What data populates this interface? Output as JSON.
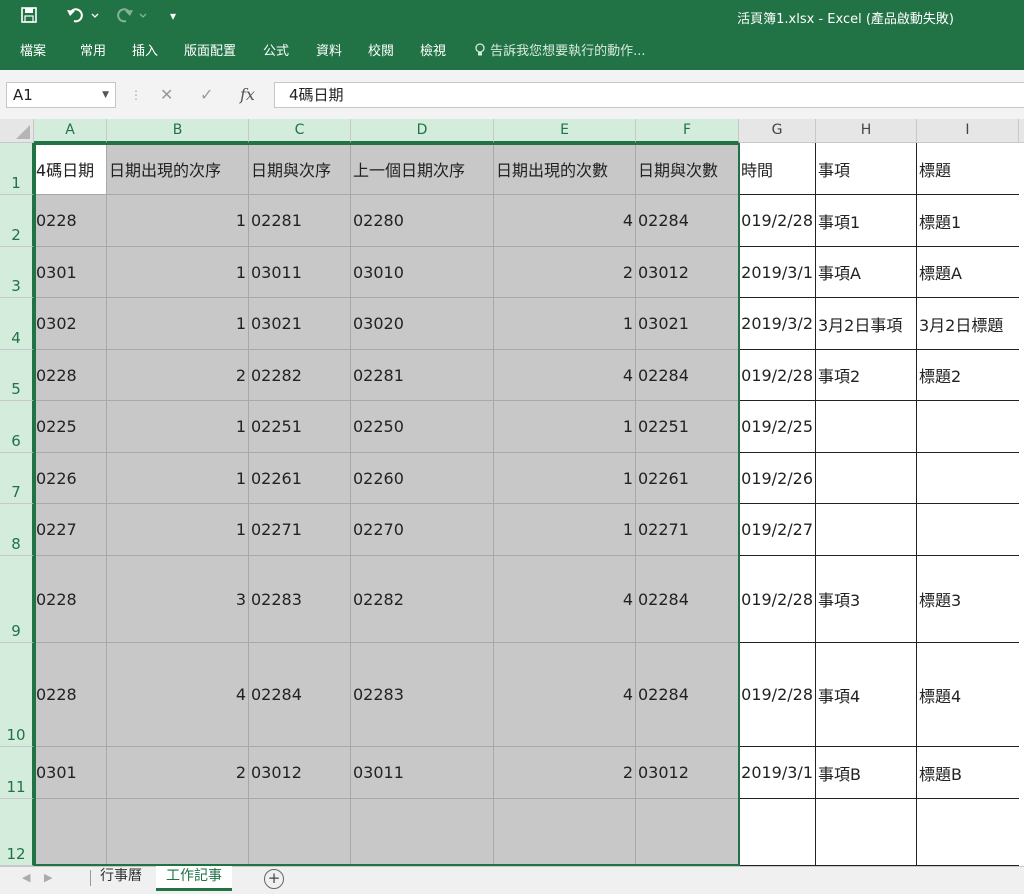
{
  "window": {
    "title": "活頁簿1.xlsx - Excel (產品啟動失敗)"
  },
  "quick_access": {
    "save_icon": "save-icon",
    "undo_icon": "undo-icon",
    "redo_icon": "redo-icon",
    "customize_icon": "customize-icon"
  },
  "menu": [
    "檔案",
    "常用",
    "插入",
    "版面配置",
    "公式",
    "資料",
    "校閱",
    "檢視"
  ],
  "tell_me": "告訴我您想要執行的動作...",
  "name_box": "A1",
  "formula_bar": {
    "fx": "fx",
    "value": "4碼日期"
  },
  "columns": [
    "A",
    "B",
    "C",
    "D",
    "E",
    "F",
    "G",
    "H",
    "I"
  ],
  "rows": [
    "1",
    "2",
    "3",
    "4",
    "5",
    "6",
    "7",
    "8",
    "9",
    "10",
    "11",
    "12"
  ],
  "cells": [
    [
      "4碼日期",
      "日期出現的次序",
      "日期與次序",
      "上一個日期次序",
      "日期出現的次數",
      "日期與次數",
      "時間",
      "事項",
      "標題"
    ],
    [
      "0228",
      "1",
      "02281",
      "02280",
      "4",
      "02284",
      "2019/2/28",
      "事項1",
      "標題1"
    ],
    [
      "0301",
      "1",
      "03011",
      "03010",
      "2",
      "03012",
      "2019/3/1",
      "事項A",
      "標題A"
    ],
    [
      "0302",
      "1",
      "03021",
      "03020",
      "1",
      "03021",
      "2019/3/2",
      "3月2日事項",
      "3月2日標題"
    ],
    [
      "0228",
      "2",
      "02282",
      "02281",
      "4",
      "02284",
      "2019/2/28",
      "事項2",
      "標題2"
    ],
    [
      "0225",
      "1",
      "02251",
      "02250",
      "1",
      "02251",
      "2019/2/25",
      "",
      ""
    ],
    [
      "0226",
      "1",
      "02261",
      "02260",
      "1",
      "02261",
      "2019/2/26",
      "",
      ""
    ],
    [
      "0227",
      "1",
      "02271",
      "02270",
      "1",
      "02271",
      "2019/2/27",
      "",
      ""
    ],
    [
      "0228",
      "3",
      "02283",
      "02282",
      "4",
      "02284",
      "2019/2/28",
      "事項3",
      "標題3"
    ],
    [
      "0228",
      "4",
      "02284",
      "02283",
      "4",
      "02284",
      "2019/2/28",
      "事項4",
      "標題4"
    ],
    [
      "0301",
      "2",
      "03012",
      "03011",
      "2",
      "03012",
      "2019/3/1",
      "事項B",
      "標題B"
    ],
    [
      "",
      "",
      "",
      "",
      "",
      "",
      "",
      "",
      ""
    ]
  ],
  "sheet_tabs": [
    {
      "label": "行事曆",
      "active": false
    },
    {
      "label": "工作記事",
      "active": true
    }
  ],
  "colors": {
    "excel_green": "#217346",
    "selection_shade": "#c8c8c8"
  }
}
